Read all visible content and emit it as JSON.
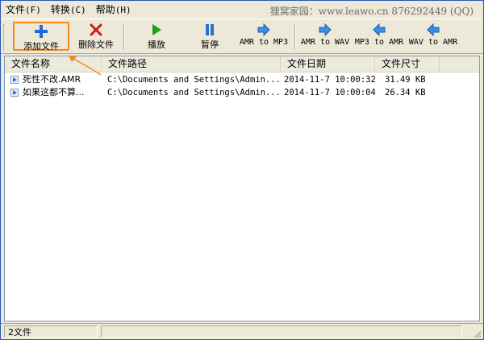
{
  "menu": {
    "items": [
      {
        "label": "文件",
        "accel": "(F)"
      },
      {
        "label": "转换",
        "accel": "(C)"
      },
      {
        "label": "帮助",
        "accel": "(H)"
      }
    ],
    "credit": "狸窝家园：www.leawo.cn 876292449 (QQ)"
  },
  "toolbar": {
    "add_label": "添加文件",
    "delete_label": "删除文件",
    "play_label": "播放",
    "pause_label": "暂停",
    "amr_to_mp3_label": "AMR to MP3",
    "amr_to_wav_label": "AMR to WAV",
    "mp3_to_amr_label": "MP3 to AMR",
    "wav_to_amr_label": "WAV to AMR",
    "colors": {
      "add": "#1a6fd6",
      "delete": "#d01818",
      "play": "#1aa01a",
      "pause": "#2a6fd6",
      "arrow": "#3a8ee6",
      "highlight": "#f08a1e"
    }
  },
  "list": {
    "columns": [
      "文件名称",
      "文件路径",
      "文件日期",
      "文件尺寸"
    ],
    "rows": [
      {
        "name": "死性不改.AMR",
        "path": "C:\\Documents and Settings\\Admin...",
        "date": "2014-11-7 10:00:32",
        "size": "31.49 KB"
      },
      {
        "name": "如果这都不算...",
        "path": "C:\\Documents and Settings\\Admin...",
        "date": "2014-11-7 10:00:04",
        "size": "26.34 KB"
      }
    ]
  },
  "status": {
    "count": "2文件"
  }
}
